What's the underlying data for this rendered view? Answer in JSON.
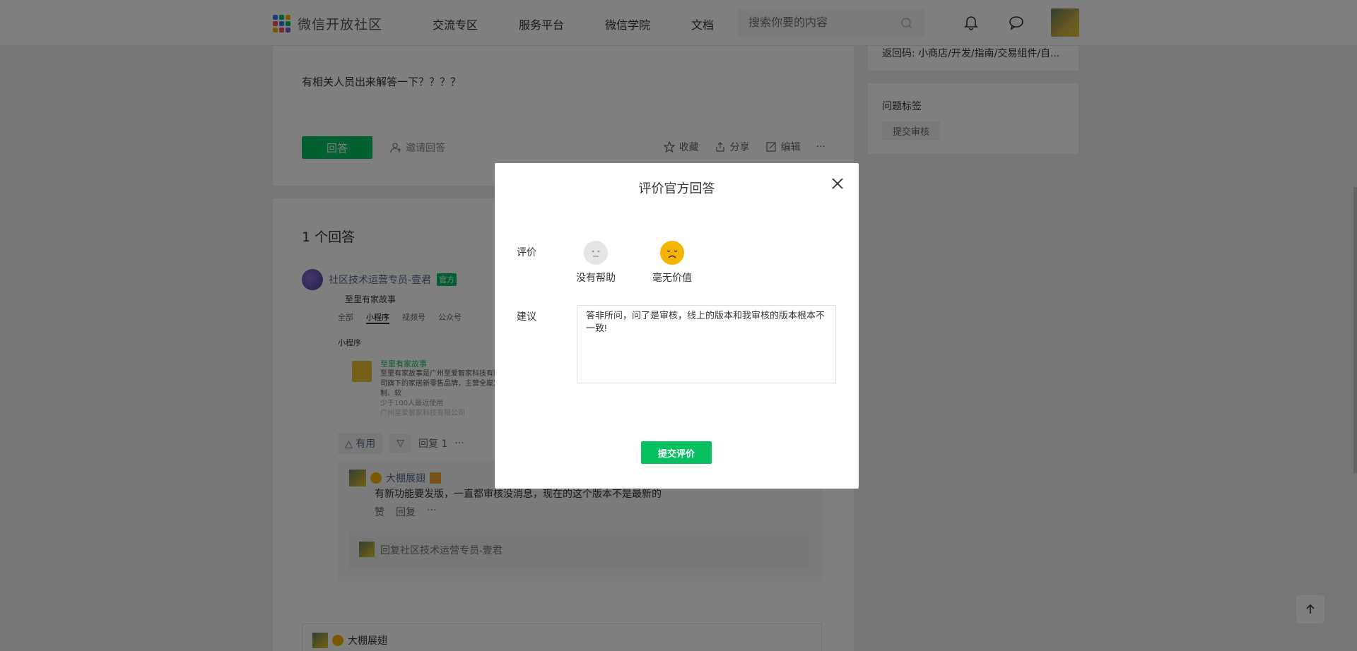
{
  "header": {
    "logo_text": "微信开放社区",
    "logo_colors": [
      "#2b7cf3",
      "#07c160",
      "#f5b400",
      "#fa5151",
      "#2b7cf3",
      "#07c160",
      "#f5b400",
      "#fa5151",
      "#7b5cd6"
    ],
    "nav": [
      "交流专区",
      "服务平台",
      "微信学院",
      "文档"
    ],
    "search_placeholder": "搜索你要的内容",
    "icons": [
      "search-icon",
      "bell-icon",
      "chat-bubble-icon"
    ]
  },
  "question": {
    "text": "有相关人员出来解答一下？？？？",
    "answer_button": "回答",
    "invite_label": "邀请回答",
    "actions": [
      "收藏",
      "分享",
      "编辑",
      "···"
    ]
  },
  "answers": {
    "count_label": "1 个回答",
    "author": "社区技术运营专员-壹君",
    "official_badge": "官方",
    "screenshot": {
      "title": "至里有家故事",
      "tabs": [
        "全部",
        "小程序",
        "视频号",
        "公众号"
      ],
      "section": "小程序",
      "item_title": "至里有家故事",
      "item_desc": "至里有家故事是广州至爱智家科技有限公司旗下的家居新零售品牌，主营全屋定制、软",
      "item_users": "少于100人最近使用",
      "item_company": "广州至爱智家科技有限公司"
    },
    "useful_label": "△ 有用",
    "down_label": "▽",
    "reply_label": "回复 1",
    "more_label": "···",
    "reply": {
      "author": "大棚展翅",
      "text": "有新功能要发版，一直都审核没消息，现在的这个版本不是最新的",
      "like_label": "赞",
      "reply_label": "回复",
      "more_label": "···",
      "input_placeholder": "回复社区技术运营专员-壹君"
    },
    "next_author": "大棚展翅"
  },
  "sidebar": {
    "return_code": "返回码: 小商店/开发/指南/交易组件/自...",
    "tags_title": "问题标签",
    "tag": "提交审核"
  },
  "modal": {
    "title": "评价官方回答",
    "rating_label": "评价",
    "options": [
      "没有帮助",
      "毫无价值"
    ],
    "selected_option": "毫无价值",
    "suggestion_label": "建议",
    "suggestion_value": "答非所问，问了是审核，线上的版本和我审核的版本根本不一致!",
    "submit_label": "提交评价"
  },
  "colors": {
    "accent": "#07c160",
    "link": "#576b95",
    "overlay": "rgba(0,0,0,0.5)"
  }
}
